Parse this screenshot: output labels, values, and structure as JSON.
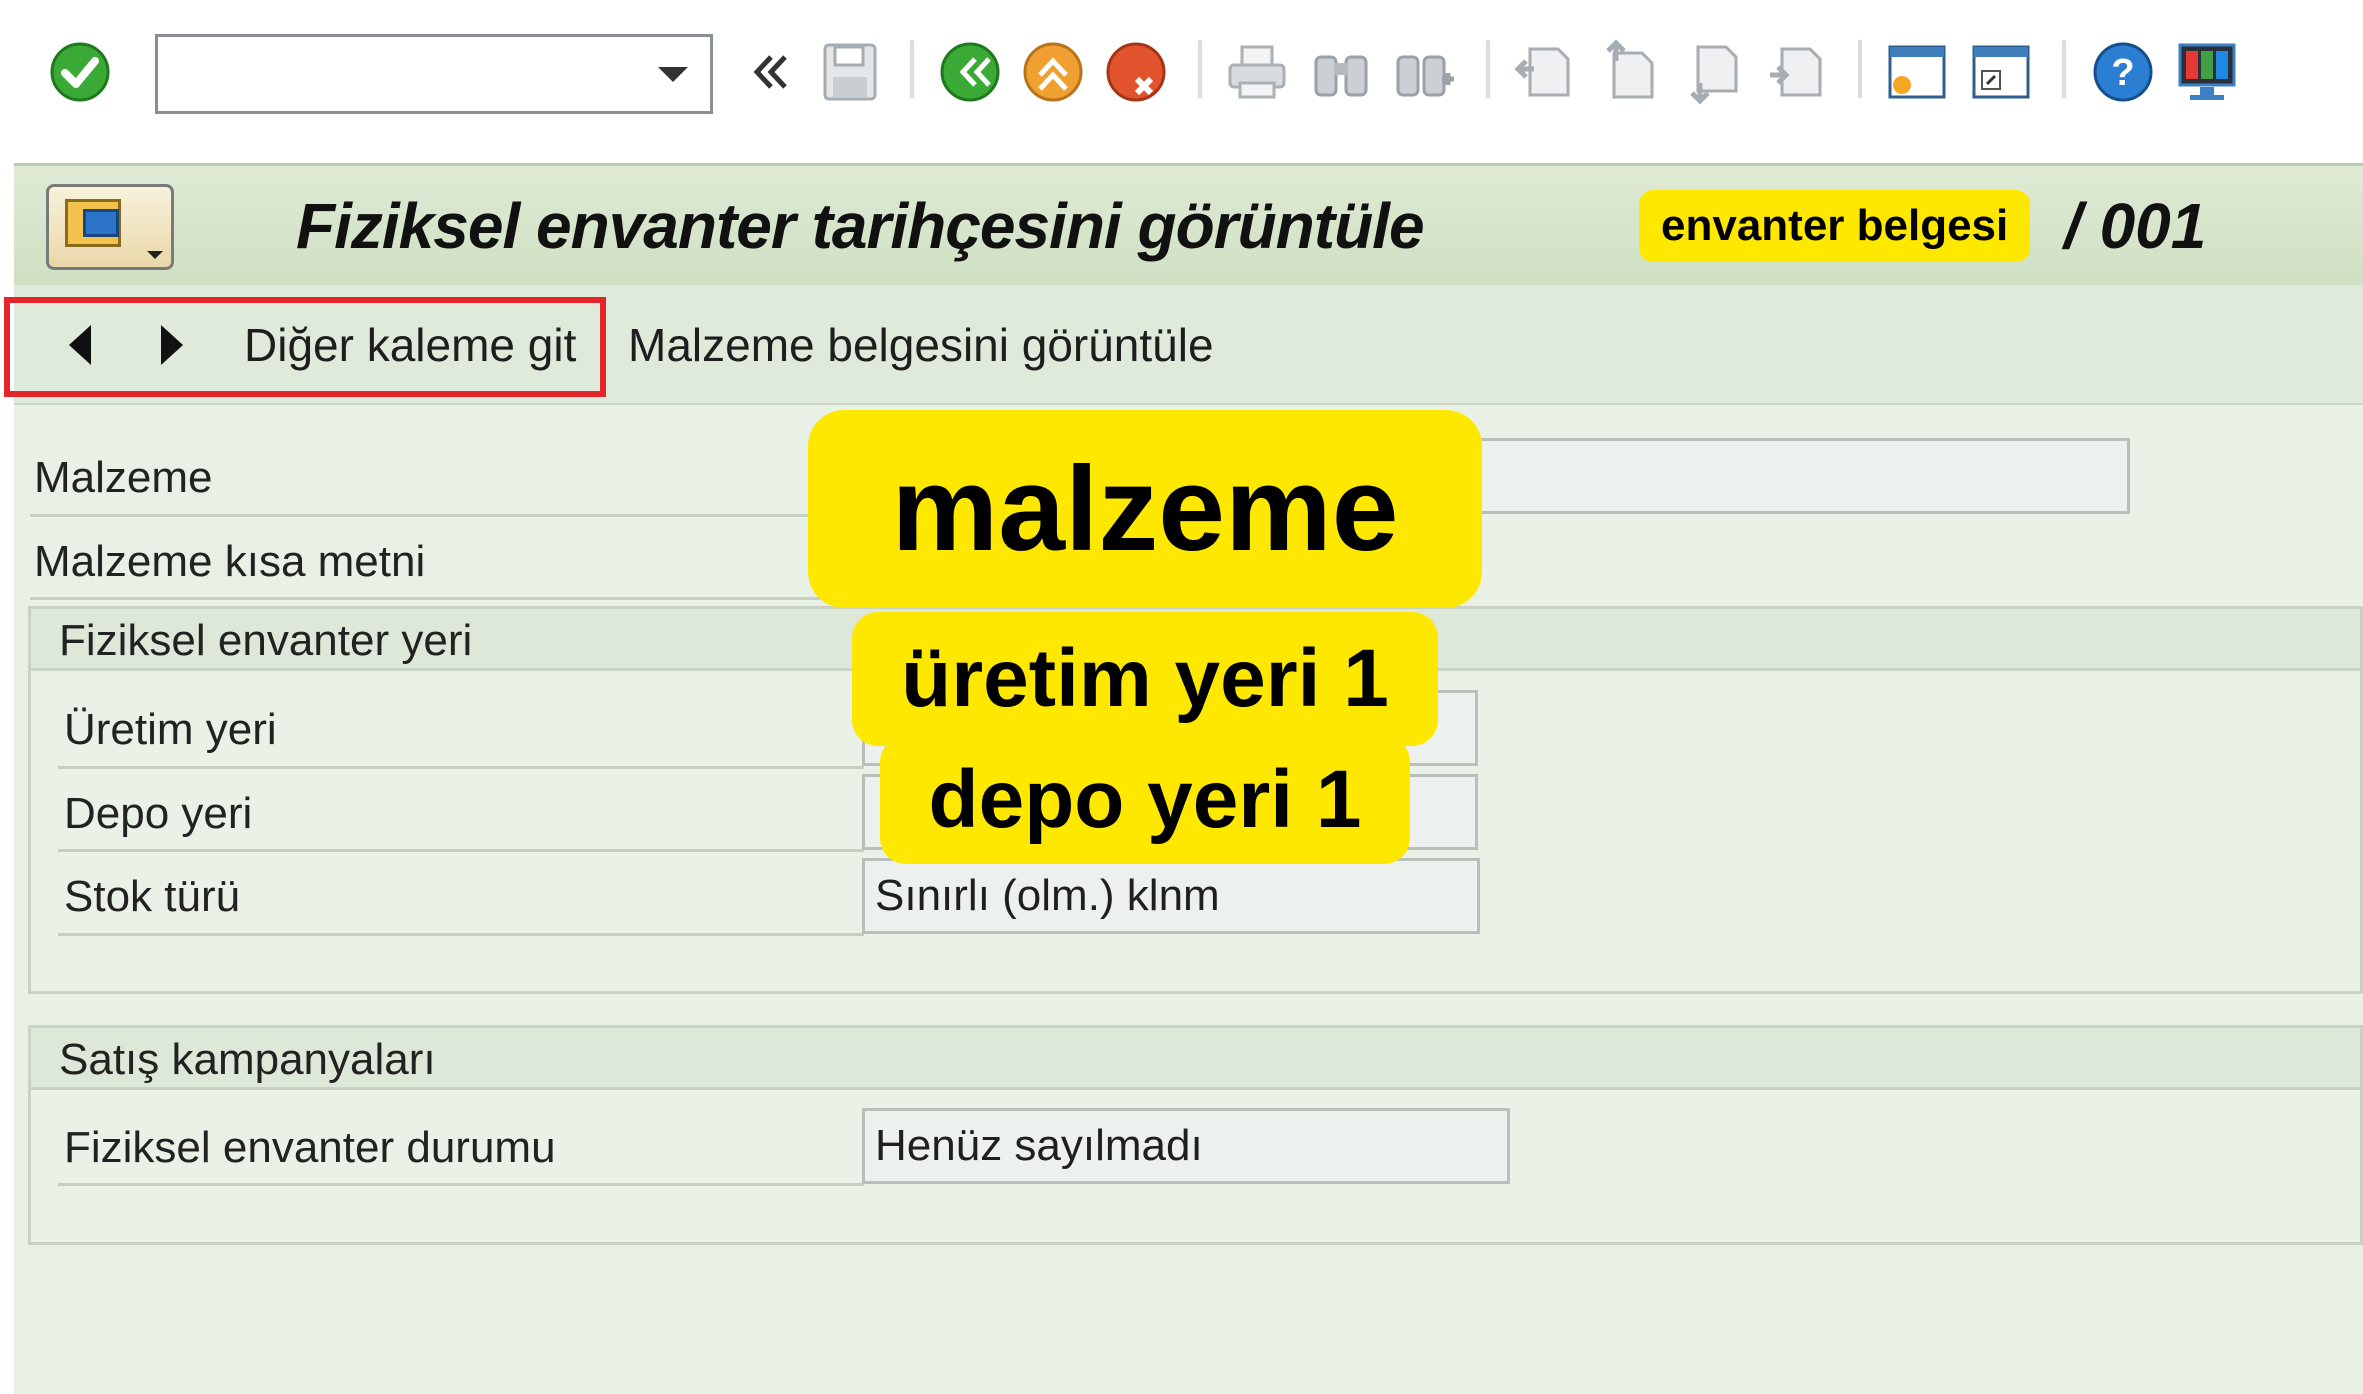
{
  "toolbar": {
    "command_field_value": "",
    "icons": [
      {
        "name": "enter-icon",
        "color": "#3aa935"
      },
      {
        "name": "back-icon"
      },
      {
        "name": "save-icon"
      },
      {
        "name": "exit-icon",
        "color": "#3aa935"
      },
      {
        "name": "up-icon",
        "color": "#f0a030"
      },
      {
        "name": "cancel-icon",
        "color": "#e0532c"
      },
      {
        "name": "print-icon"
      },
      {
        "name": "find-icon"
      },
      {
        "name": "find-next-icon"
      },
      {
        "name": "first-page-icon"
      },
      {
        "name": "previous-page-icon"
      },
      {
        "name": "next-page-icon"
      },
      {
        "name": "last-page-icon"
      },
      {
        "name": "create-session-icon"
      },
      {
        "name": "create-shortcut-icon"
      },
      {
        "name": "help-icon",
        "color": "#2b7fd3"
      },
      {
        "name": "customize-layout-icon"
      }
    ]
  },
  "title": {
    "text": "Fiziksel envanter tarihçesini görüntüle",
    "badge": "envanter belgesi",
    "suffix": "/ 001"
  },
  "app_toolbar": {
    "goto_other_item": "Diğer kaleme git",
    "show_material_doc": "Malzeme belgesini görüntüle"
  },
  "fields": {
    "material_label": "Malzeme",
    "material_value": "",
    "material_short_text_label": "Malzeme kısa metni",
    "material_short_text_value": ""
  },
  "group_location": {
    "title": "Fiziksel envanter yeri",
    "plant_label": "Üretim yeri",
    "plant_value": "",
    "storage_label": "Depo yeri",
    "storage_value": "",
    "stock_type_label": "Stok türü",
    "stock_type_value": "Sınırlı (olm.) klnm"
  },
  "group_sales": {
    "title": "Satış kampanyaları",
    "status_label": "Fiziksel envanter durumu",
    "status_value": "Henüz sayılmadı"
  },
  "overlays": {
    "material": "malzeme",
    "plant": "üretim yeri 1",
    "storage": "depo yeri 1"
  },
  "colors": {
    "highlight": "#ffe800",
    "nav_outline": "#e3262b",
    "title_bar": "#cfe0c3"
  }
}
